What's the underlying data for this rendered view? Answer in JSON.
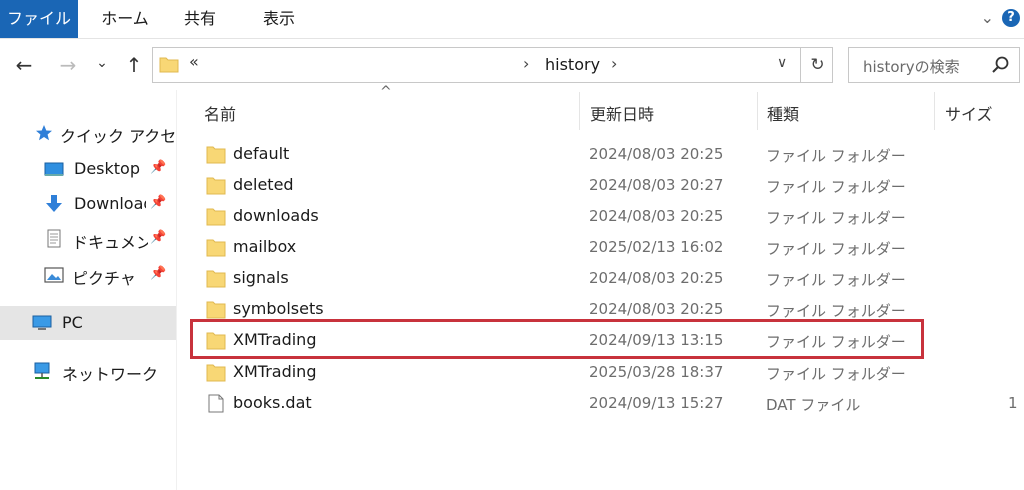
{
  "ribbon": {
    "tabs": [
      {
        "label": "ファイル"
      },
      {
        "label": "ホーム"
      },
      {
        "label": "共有"
      },
      {
        "label": "表示"
      }
    ],
    "help": "?"
  },
  "nav": {
    "back": "←",
    "forward": "→",
    "recent": "⌄",
    "up": "↑"
  },
  "address": {
    "overflow": "«",
    "path": "history"
  },
  "search": {
    "placeholder": "historyの検索"
  },
  "sidebar": {
    "items": [
      {
        "label": "クイック アクセス",
        "icon": "star-icon"
      },
      {
        "label": "Desktop",
        "icon": "desktop-icon"
      },
      {
        "label": "Downloads",
        "icon": "download-icon"
      },
      {
        "label": "ドキュメント",
        "icon": "document-icon"
      },
      {
        "label": "ピクチャ",
        "icon": "picture-icon"
      },
      {
        "label": "PC",
        "icon": "pc-icon"
      },
      {
        "label": "ネットワーク",
        "icon": "network-icon"
      }
    ]
  },
  "columns": {
    "name": "名前",
    "date": "更新日時",
    "type": "種類",
    "size": "サイズ"
  },
  "files": [
    {
      "name": "default",
      "date": "2024/08/03 20:25",
      "type": "ファイル フォルダー",
      "size": "",
      "icon": "folder-icon"
    },
    {
      "name": "deleted",
      "date": "2024/08/03 20:27",
      "type": "ファイル フォルダー",
      "size": "",
      "icon": "folder-icon"
    },
    {
      "name": "downloads",
      "date": "2024/08/03 20:25",
      "type": "ファイル フォルダー",
      "size": "",
      "icon": "folder-icon"
    },
    {
      "name": "mailbox",
      "date": "2025/02/13 16:02",
      "type": "ファイル フォルダー",
      "size": "",
      "icon": "folder-icon"
    },
    {
      "name": "signals",
      "date": "2024/08/03 20:25",
      "type": "ファイル フォルダー",
      "size": "",
      "icon": "folder-icon"
    },
    {
      "name": "symbolsets",
      "date": "2024/08/03 20:25",
      "type": "ファイル フォルダー",
      "size": "",
      "icon": "folder-icon"
    },
    {
      "name": "XMTrading",
      "date": "2024/09/13 13:15",
      "type": "ファイル フォルダー",
      "size": "",
      "icon": "folder-icon"
    },
    {
      "name": "XMTrading",
      "date": "2025/03/28 18:37",
      "type": "ファイル フォルダー",
      "size": "",
      "icon": "folder-icon"
    },
    {
      "name": "books.dat",
      "date": "2024/09/13 15:27",
      "type": "DAT ファイル",
      "size": "1",
      "icon": "file-icon"
    }
  ],
  "colors": {
    "accent": "#1a66b5",
    "highlight": "#c8323c",
    "folder": "#f8d775"
  }
}
